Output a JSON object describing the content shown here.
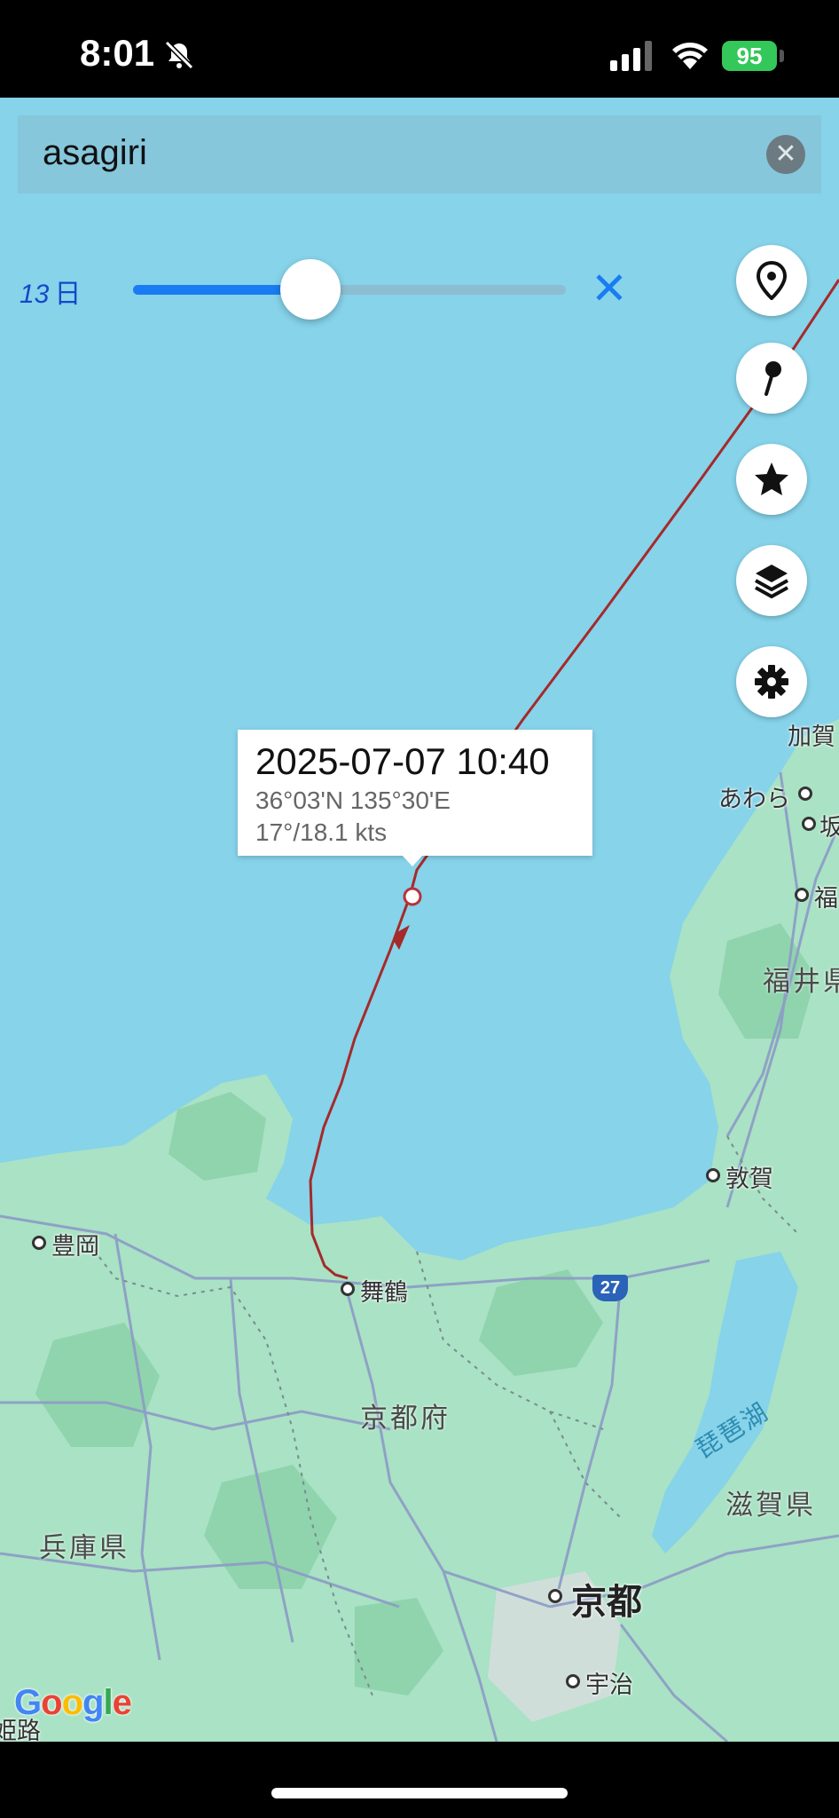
{
  "status_bar": {
    "time": "8:01",
    "battery": "95"
  },
  "search": {
    "query": "asagiri",
    "clear_icon": "x-circle-icon"
  },
  "zoom": {
    "value": "13",
    "unit": "日",
    "level_fraction": 0.41
  },
  "toolbar": {
    "buttons": [
      "map-marker-icon",
      "pin-icon",
      "star-icon",
      "layers-icon",
      "gear-icon"
    ]
  },
  "vessel_popup": {
    "timestamp": "2025-07-07 10:40",
    "position": "36°03'N 135°30'E",
    "course_speed": "17°/18.1 kts"
  },
  "map": {
    "places": {
      "kaga": "加賀",
      "awara": "あわら",
      "saka": "坂",
      "fuku": "福",
      "fukui_pref": "福井県",
      "tsuruga": "敦賀",
      "toyooka": "豊岡",
      "maizuru": "舞鶴",
      "kyoto_pref": "京都府",
      "biwa_lake": "琵琶湖",
      "shiga_pref": "滋賀県",
      "hyogo_pref": "兵庫県",
      "kyoto_city": "京都",
      "uji": "宇治",
      "himeji": "姫路"
    },
    "route_shield": "27",
    "attribution": "Google",
    "colors": {
      "sea": "#86d3ea",
      "land": "#a9e2c4",
      "track": "#a52a2a"
    }
  }
}
